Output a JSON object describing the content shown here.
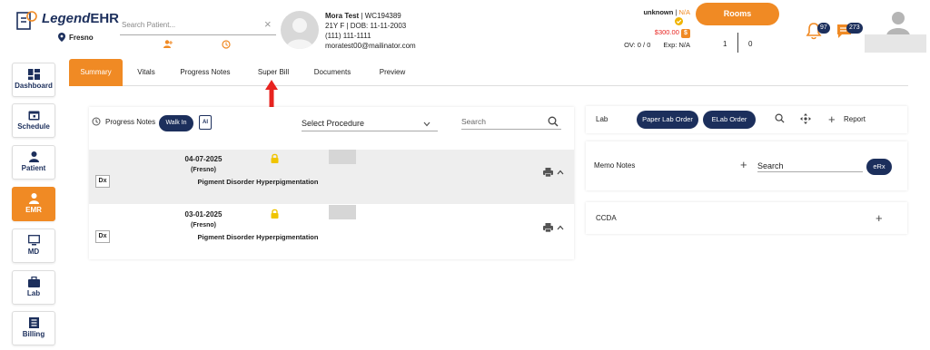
{
  "header": {
    "logo_prefix": "Legend",
    "logo_suffix": "EHR",
    "location": "Fresno",
    "search_placeholder": "Search Patient...",
    "search_clear": "×",
    "patient": {
      "name": "Mora Test",
      "id": "WC194389",
      "demographics": "21Y F | DOB: 11-11-2003",
      "phone": "(111) 111-1111",
      "email": "moratest00@mailinator.com"
    },
    "insurance_status": "unknown",
    "insurance_value": "N/A",
    "balance": "$300.00",
    "ov": "OV: 0 / 0",
    "exp": "Exp: N/A",
    "rooms_label": "Rooms",
    "room_count_left": "1",
    "room_count_right": "0",
    "notifications_count": "97",
    "messages_count": "273"
  },
  "sidebar": {
    "items": [
      {
        "label": "Dashboard"
      },
      {
        "label": "Schedule"
      },
      {
        "label": "Patient"
      },
      {
        "label": "EMR"
      },
      {
        "label": "MD"
      },
      {
        "label": "Lab"
      },
      {
        "label": "Billing"
      }
    ]
  },
  "tabs": [
    {
      "label": "Summary"
    },
    {
      "label": "Vitals"
    },
    {
      "label": "Progress Notes"
    },
    {
      "label": "Super Bill"
    },
    {
      "label": "Documents"
    },
    {
      "label": "Preview"
    }
  ],
  "progress": {
    "label": "Progress Notes",
    "walkin_label": "Walk In",
    "ai_label": "AI",
    "procedure_select": "Select Procedure",
    "search_placeholder": "Search",
    "encounters": [
      {
        "date": "04-07-2025",
        "location": "(Fresno)",
        "dx": "Dx",
        "diagnosis": "Pigment Disorder Hyperpigmentation"
      },
      {
        "date": "03-01-2025",
        "location": "(Fresno)",
        "dx": "Dx",
        "diagnosis": "Pigment Disorder Hyperpigmentation"
      }
    ]
  },
  "lab": {
    "label": "Lab",
    "paper_order": "Paper Lab Order",
    "elab_order": "ELab Order",
    "report": "Report"
  },
  "memo": {
    "label": "Memo Notes",
    "search_placeholder": "Search",
    "erx": "eRx"
  },
  "ccda": {
    "label": "CCDA"
  },
  "colors": {
    "accent": "#f08a24",
    "navy": "#1c2f5c",
    "annotation_arrow": "#e8231f"
  }
}
